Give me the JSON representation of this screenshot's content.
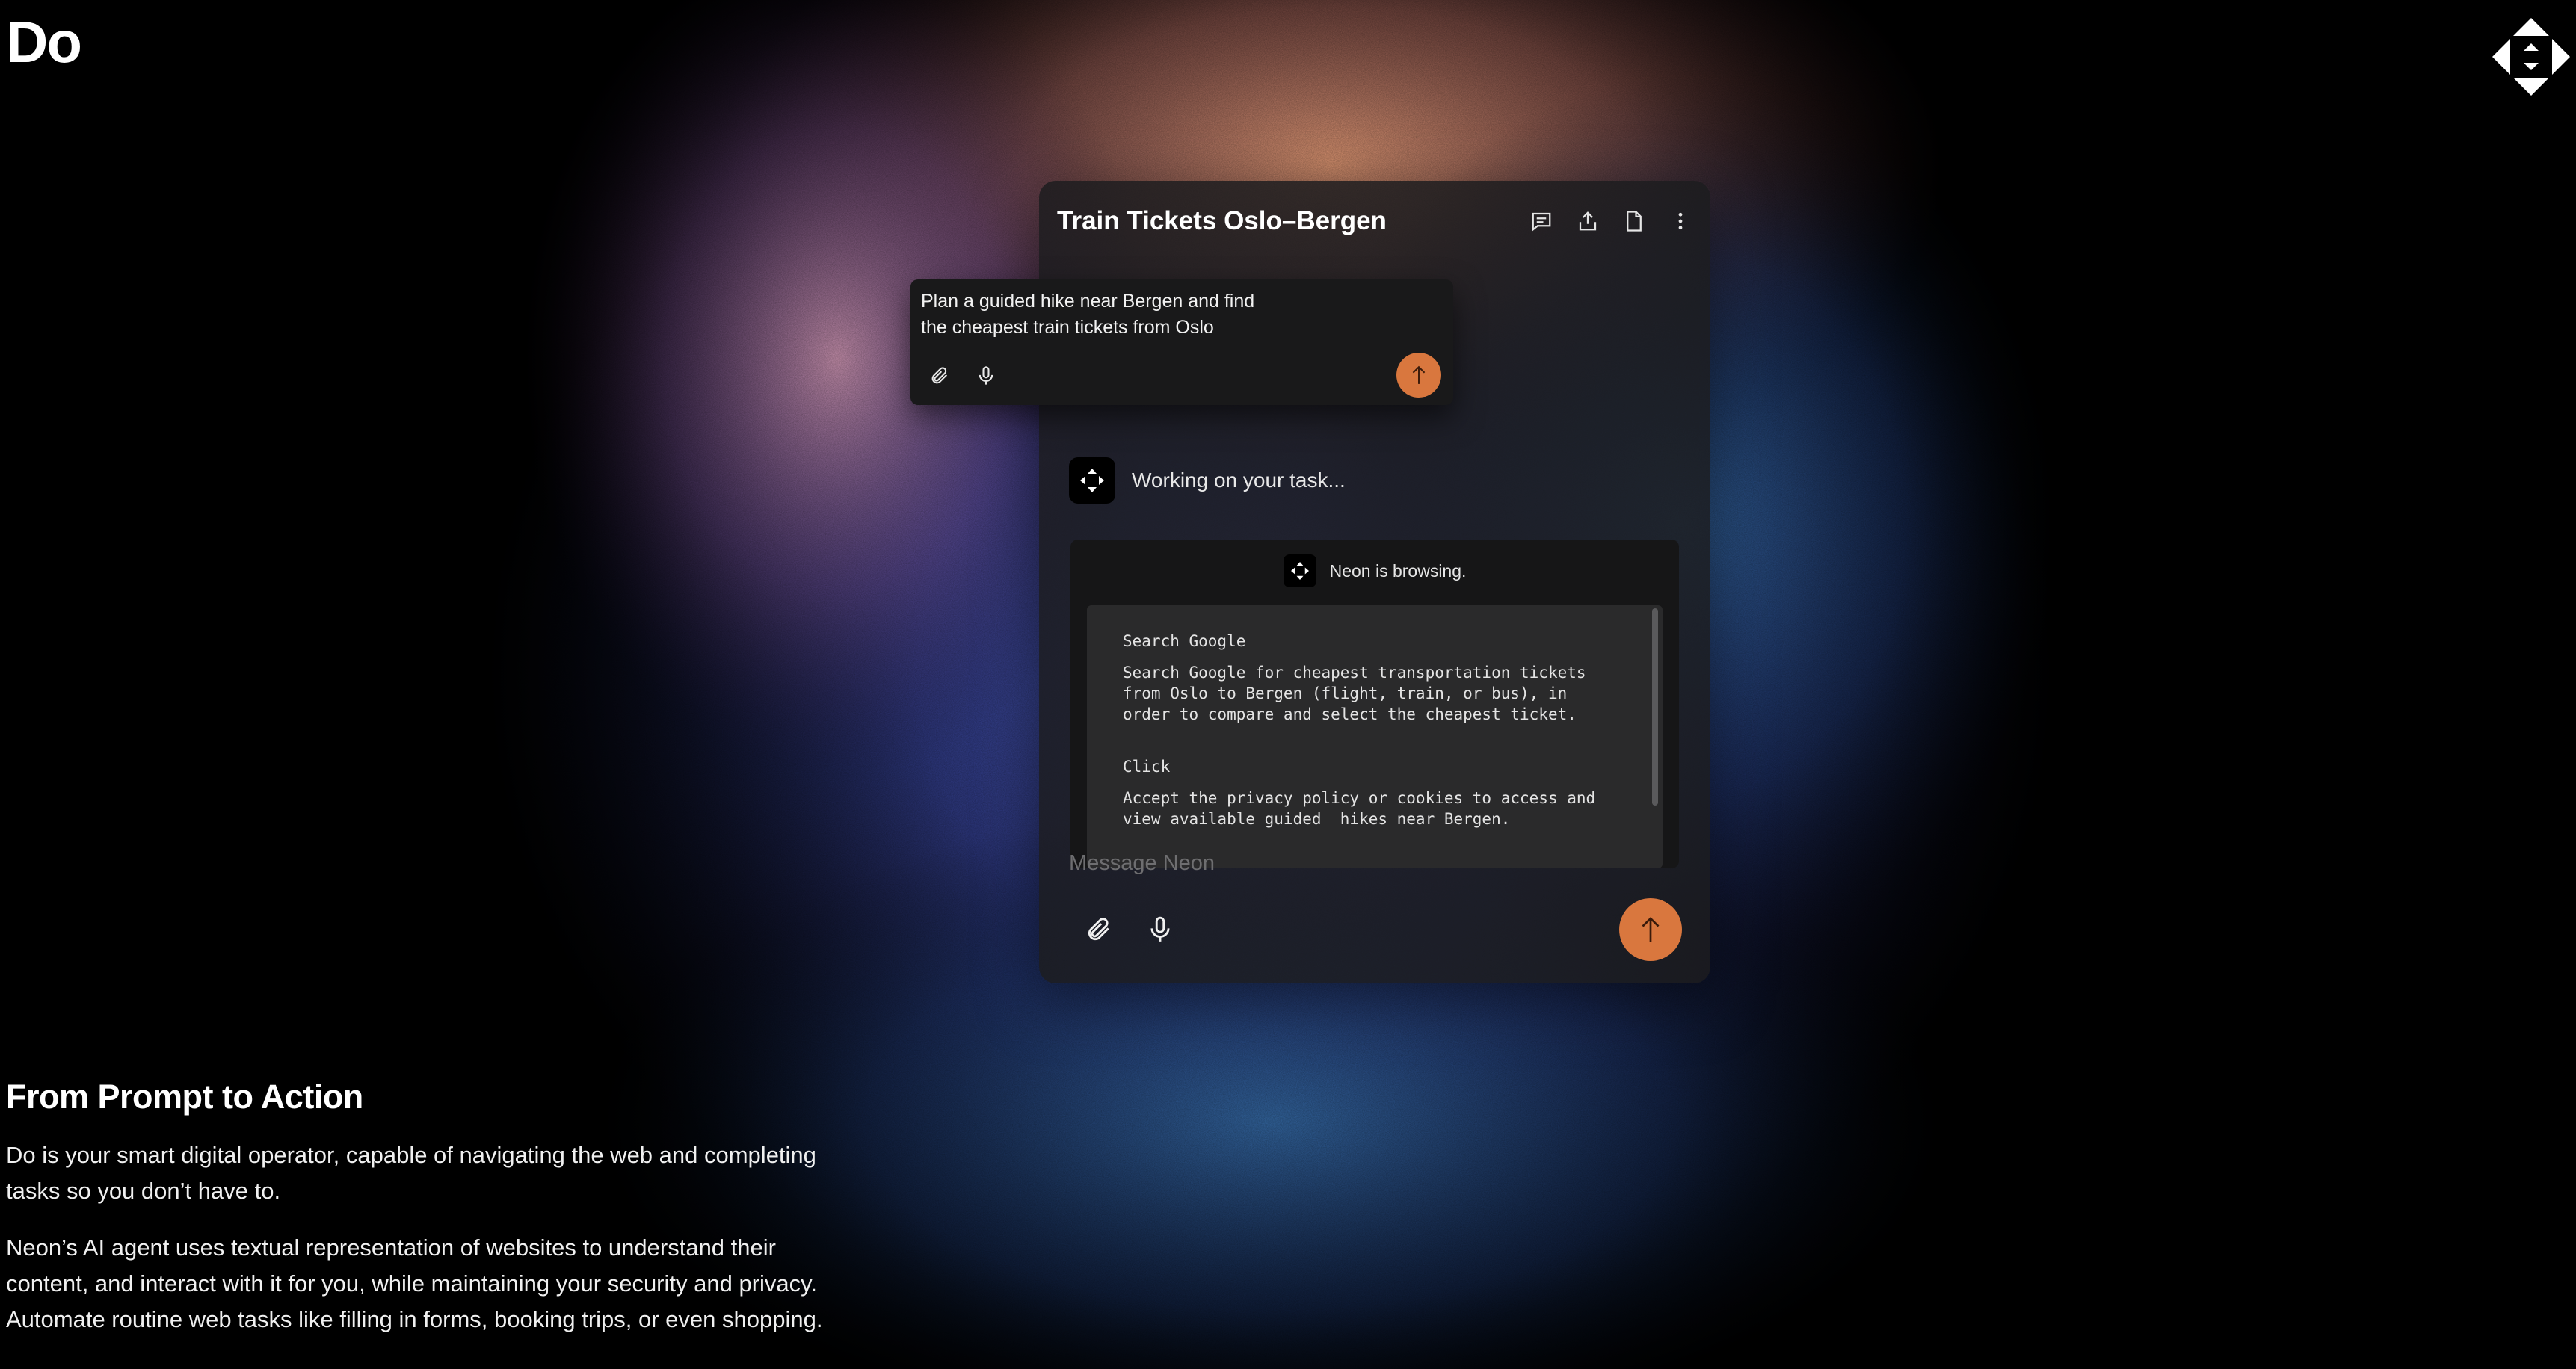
{
  "brand": {
    "name": "Do"
  },
  "chat": {
    "title": "Train Tickets Oslo–Bergen",
    "header_icons": [
      "chat-bubble-icon",
      "share-icon",
      "document-icon",
      "more-vertical-icon"
    ],
    "prompt": {
      "line1": "Plan a guided hike near Bergen and find",
      "line2": "the cheapest train tickets from Oslo"
    },
    "status": "Working on your task...",
    "browsing_label": "Neon is browsing.",
    "log": [
      {
        "action": "Search Google",
        "description": "Search Google for cheapest transportation tickets\nfrom Oslo to Bergen (flight, train, or bus), in\norder to compare and select the cheapest ticket."
      },
      {
        "action": "Click",
        "description": "Accept the privacy policy or cookies to access and\nview available guided  hikes near Bergen."
      }
    ],
    "composer": {
      "placeholder": "Message Neon"
    }
  },
  "marketing": {
    "heading": "From Prompt to Action",
    "paragraph1_line1": "Do is your smart digital operator, capable of navigating the web and completing",
    "paragraph1_line2": "tasks so you don’t have to.",
    "paragraph2_line1": "Neon’s AI agent uses textual representation of websites to understand their",
    "paragraph2_line2": "content, and interact with it for you, while maintaining your security and privacy.",
    "paragraph2_line3": "Automate routine web tasks like filling in forms, booking trips, or even shopping."
  },
  "colors": {
    "accent": "#d9773e",
    "background": "#000000",
    "panel": "#1c1c1e",
    "glow_orange": "#e0956a",
    "glow_blue": "#4a5ec8"
  }
}
